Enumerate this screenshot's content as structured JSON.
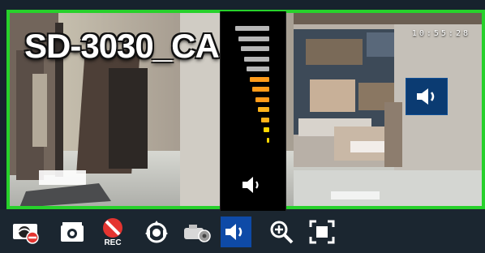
{
  "camera": {
    "title": "SD-3030_CA",
    "timestamp": "10:55:28"
  },
  "volume": {
    "level_bars_lit": 7,
    "total_bars": 12,
    "colors": {
      "inactive": "#b7b7b7",
      "active_top": "#ff9b1a",
      "active_bottom": "#ffd700",
      "frame": "#27d12b",
      "panel": "#000000",
      "toolbar": "#1b2630",
      "active_tool": "#0e4aa7"
    }
  },
  "toolbar": {
    "items": [
      {
        "icon": "stream-disable-icon"
      },
      {
        "icon": "snapshot-icon"
      },
      {
        "icon": "record-icon",
        "label": "REC"
      },
      {
        "icon": "ptz-icon"
      },
      {
        "icon": "camera-settings-icon"
      },
      {
        "icon": "speaker-icon"
      },
      {
        "icon": "zoom-in-icon"
      },
      {
        "icon": "fullscreen-icon"
      }
    ]
  }
}
